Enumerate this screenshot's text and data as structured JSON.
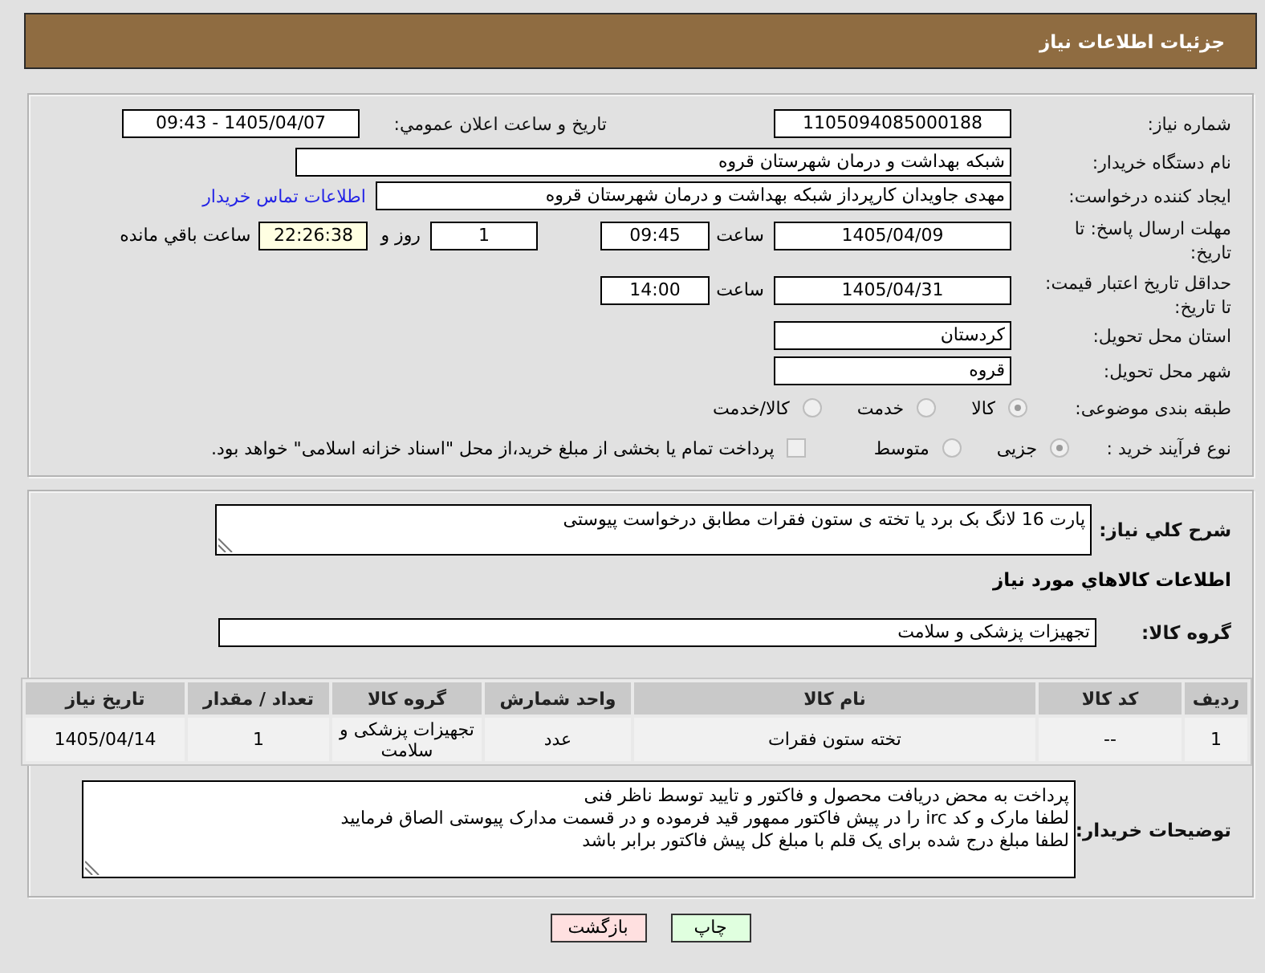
{
  "header": {
    "title": "جزئیات اطلاعات نیاز"
  },
  "summary": {
    "need_number": {
      "label": "شماره نیاز:",
      "value": "1105094085000188"
    },
    "announcement": {
      "label": "تاریخ و ساعت اعلان عمومي:",
      "value": "1405/04/07 - 09:43"
    },
    "buyer_org": {
      "label": "نام دستگاه خریدار:",
      "value": "شبکه بهداشت و درمان شهرستان قروه"
    },
    "requester": {
      "label": "ایجاد کننده درخواست:",
      "value": "مهدی جاویدان کارپرداز شبکه بهداشت و درمان شهرستان قروه",
      "contact_link": "اطلاعات تماس خریدار"
    },
    "reply_deadline": {
      "label": "مهلت ارسال پاسخ: تا تاریخ:",
      "date": "1405/04/09",
      "time_label": "ساعت",
      "time": "09:45",
      "days": "1",
      "days_label": "روز و",
      "remaining": "22:26:38",
      "remaining_label": "ساعت باقي مانده"
    },
    "price_validity": {
      "label": "حداقل تاریخ اعتبار قیمت: تا تاریخ:",
      "date": "1405/04/31",
      "time_label": "ساعت",
      "time": "14:00"
    },
    "delivery_province": {
      "label": "استان محل تحویل:",
      "value": "کردستان"
    },
    "delivery_city": {
      "label": "شهر محل تحویل:",
      "value": "قروه"
    },
    "category": {
      "label": "طبقه بندی موضوعی:",
      "options": [
        {
          "label": "کالا",
          "selected": true
        },
        {
          "label": "خدمت",
          "selected": false
        },
        {
          "label": "کالا/خدمت",
          "selected": false
        }
      ]
    },
    "purchase_process": {
      "label": "نوع فرآیند خرید :",
      "options": [
        {
          "label": "جزیی",
          "selected": true
        },
        {
          "label": "متوسط",
          "selected": false
        }
      ],
      "treasury_payment": {
        "label": "پرداخت تمام یا بخشی از مبلغ خرید،از محل \"اسناد خزانه اسلامی\" خواهد بود.",
        "checked": false
      }
    }
  },
  "details": {
    "need_description": {
      "label": "شرح کلي نیاز:",
      "value": "پارت 16 لانگ بک برد یا تخته ی ستون فقرات مطابق درخواست پیوستی"
    },
    "goods_heading": "اطلاعات کالاهاي مورد نیاز",
    "goods_group": {
      "label": "گروه کالا:",
      "value": "تجهیزات پزشکی و سلامت"
    },
    "table": {
      "columns": [
        "ردیف",
        "کد کالا",
        "نام کالا",
        "واحد شمارش",
        "گروه کالا",
        "تعداد / مقدار",
        "تاریخ نیاز"
      ],
      "rows": [
        [
          "1",
          "--",
          "تخته ستون فقرات",
          "عدد",
          "تجهیزات پزشکی و سلامت",
          "1",
          "1405/04/14"
        ]
      ]
    },
    "buyer_notes": {
      "label": "توضیحات خریدار:",
      "value": "پرداخت به محض دریافت محصول و فاکتور و تایید توسط ناظر فنی\nلطفا مارک و کد irc  را در پیش فاکتور ممهور قید فرموده و در قسمت مدارک پیوستی الصاق فرمایید\nلطفا مبلغ درج شده برای یک قلم با مبلغ کل پیش فاکتور برابر باشد"
    }
  },
  "buttons": [
    {
      "label": "چاپ",
      "kind": "print"
    },
    {
      "label": "بازگشت",
      "kind": "back"
    }
  ]
}
